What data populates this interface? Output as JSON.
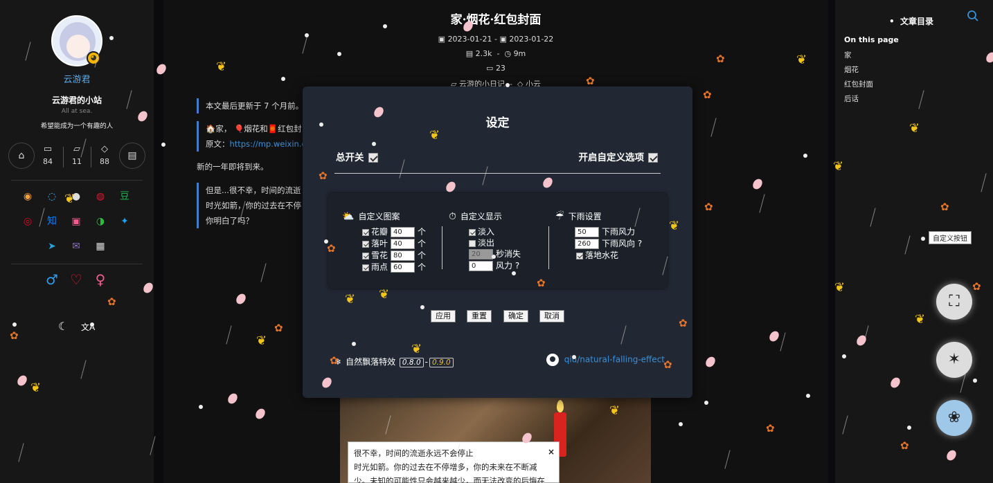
{
  "sidebar": {
    "author": "云游君",
    "site_name": "云游君的小站",
    "subtitle": "All at sea.",
    "motto": "希望能成为一个有趣的人",
    "stats": [
      {
        "icon": "archive-icon",
        "value": "84"
      },
      {
        "icon": "folder-icon",
        "value": "11"
      },
      {
        "icon": "tag-icon",
        "value": "88"
      }
    ],
    "home_icon": "⌂",
    "docs_icon": "▤",
    "socials": [
      {
        "name": "rss-icon",
        "glyph": "◉",
        "color": "#f6a23a"
      },
      {
        "name": "qq-icon",
        "glyph": "◌",
        "color": "#35b6ff"
      },
      {
        "name": "github-icon",
        "glyph": "●",
        "color": "#dddddd"
      },
      {
        "name": "weibo-icon",
        "glyph": "◍",
        "color": "#e6162d"
      },
      {
        "name": "douban-icon",
        "glyph": "豆",
        "color": "#1bb34d"
      },
      {
        "name": "netease-music-icon",
        "glyph": "◎",
        "color": "#e60026"
      },
      {
        "name": "zhihu-icon",
        "glyph": "知",
        "color": "#0a80ff"
      },
      {
        "name": "bilibili-icon",
        "glyph": "▣",
        "color": "#f25d8e"
      },
      {
        "name": "wechat-icon",
        "glyph": "◑",
        "color": "#2cbc3a"
      },
      {
        "name": "twitter-icon",
        "glyph": "✦",
        "color": "#1da1f2"
      },
      {
        "name": "telegram-icon",
        "glyph": "➤",
        "color": "#2a9fd8"
      },
      {
        "name": "email-icon",
        "glyph": "✉",
        "color": "#8e71c1"
      },
      {
        "name": "travelling-icon",
        "glyph": "▦",
        "color": "#dddddd"
      }
    ],
    "gender": [
      {
        "name": "male-icon",
        "glyph": "♂",
        "color": "#2e9ff2"
      },
      {
        "name": "heart-icon",
        "glyph": "♡",
        "color": "#e6162d"
      },
      {
        "name": "female-icon",
        "glyph": "♀",
        "color": "#f25d8e"
      }
    ],
    "dark_mode_icon": "☾",
    "lang_icon": "文A"
  },
  "post": {
    "title": "家·烟花·红包封面",
    "created": "2023-01-21",
    "dash": "-",
    "updated": "2023-01-22",
    "words": "2.3k",
    "time": "9m",
    "comments": "23",
    "category": "云游的小日记",
    "tag": "小云",
    "notice": "本文最后更新于 7 个月前。",
    "quote_line1": "🏠家，",
    "quote_line1b": "🎈烟花和🧧红包封",
    "quote_src_label": "原文：",
    "quote_src_link": "https://mp.weixin.q",
    "para1": "新的一年即将到来。",
    "quote2_line1": "但是...很不幸，时间的流逝",
    "quote2_line2": "时光如箭，你的过去在不停",
    "quote2_line3": "你明白了吗？",
    "popup_line1": "很不幸，时间的流逝永远不会停止",
    "popup_line2": "时光如箭。你的过去在不停增多，你的未来在不断减",
    "popup_line3": "少。未知的可能性只会越来越少，而无法改变的后悔在",
    "popup_close": "×"
  },
  "toc": {
    "title": "文章目录",
    "on_this_page": "On this page",
    "items": [
      "家",
      "烟花",
      "红包封面",
      "后话"
    ]
  },
  "custom_button_tooltip": "自定义按钮",
  "fabs": [
    {
      "name": "fullscreen-button",
      "glyph": "⛶"
    },
    {
      "name": "toggle-effects-button",
      "glyph": "✶"
    },
    {
      "name": "falling-settings-button",
      "glyph": "❀"
    }
  ],
  "modal": {
    "title": "设定",
    "master_switch": "总开关",
    "custom_switch": "开启自定义选项",
    "sections": {
      "pattern": {
        "title": "自定义图案",
        "icon": "⛅",
        "items": [
          {
            "label": "花瓣",
            "value": "40",
            "unit": "个",
            "checked": true
          },
          {
            "label": "落叶",
            "value": "40",
            "unit": "个",
            "checked": true
          },
          {
            "label": "雪花",
            "value": "80",
            "unit": "个",
            "checked": true
          },
          {
            "label": "雨点",
            "value": "60",
            "unit": "个",
            "checked": true
          }
        ]
      },
      "display": {
        "title": "自定义显示",
        "icon": "⏱",
        "fade_in": "淡入",
        "fade_out": "淡出",
        "fade_secs_value": "20",
        "fade_secs_label": "秒消失",
        "wind_value": "0",
        "wind_label": "风力",
        "help": "?"
      },
      "rain": {
        "title": "下雨设置",
        "icon": "☔",
        "wind_value": "50",
        "wind_label": "下雨风力",
        "dir_value": "260",
        "dir_label": "下雨风向",
        "help": "?",
        "splash_label": "落地水花"
      }
    },
    "buttons": {
      "apply": "应用",
      "reset": "重置",
      "ok": "确定",
      "cancel": "取消"
    },
    "footer_name": "自然飘落特效",
    "version_a": "0.8.0",
    "version_sep": "-",
    "version_b": "0.9.0",
    "repo_link": "qiu/natural-falling-effect"
  }
}
